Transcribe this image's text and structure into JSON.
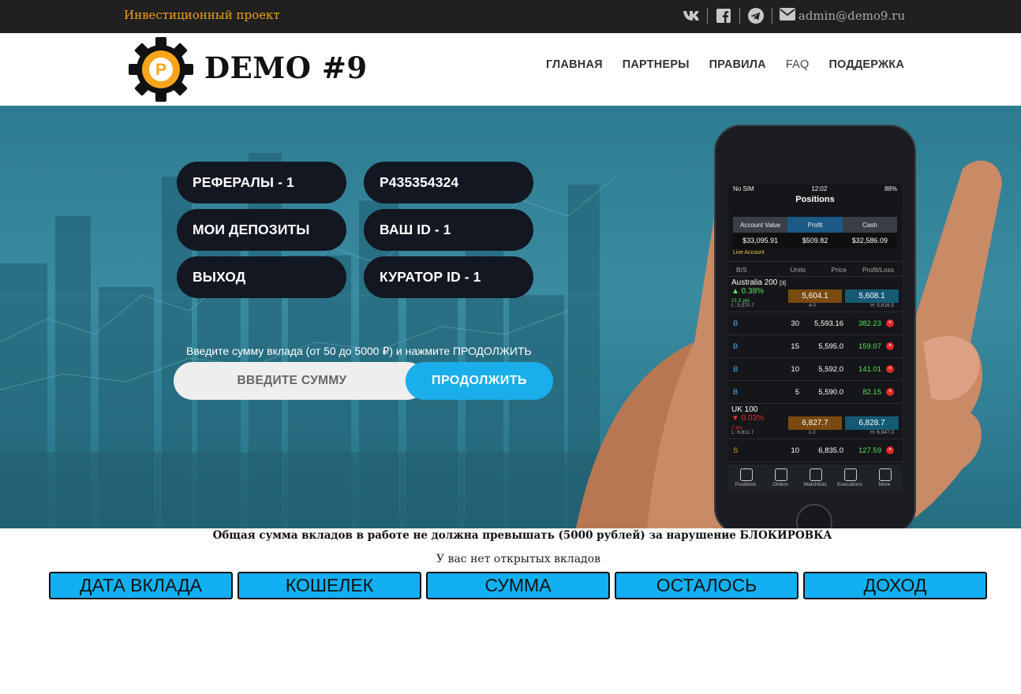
{
  "topbar": {
    "tagline": "Инвестиционный проект",
    "email": "admin@demo9.ru",
    "social_icons": [
      "vk-icon",
      "facebook-icon",
      "telegram-icon",
      "envelope-icon"
    ]
  },
  "header": {
    "logo_glyph": "P",
    "logo_text": "DEMO #9",
    "nav": [
      "ГЛАВНАЯ",
      "ПАРТНЕРЫ",
      "ПРАВИЛА",
      "FAQ",
      "ПОДДЕРЖКА"
    ]
  },
  "hero": {
    "buttons": {
      "referrals": "РЕФЕРАЛЫ - 1",
      "wallet": "P435354324",
      "deposits": "МОИ ДЕПОЗИТЫ",
      "your_id": "ВАШ ID - 1",
      "logout": "ВЫХОД",
      "curator": "КУРАТОР ID - 1"
    },
    "hint": "Введите сумму вклада (от 50 до 5000 ₽) и нажмите ПРОДОЛЖИТЬ",
    "amount_placeholder": "ВВЕДИТЕ СУММУ",
    "continue_label": "ПРОДОЛЖИТЬ"
  },
  "phone": {
    "carrier": "No SIM",
    "time": "12:02",
    "battery": "88%",
    "title": "Positions",
    "tabs": [
      "Account Value",
      "Profit",
      "Cash"
    ],
    "values": [
      "$33,095.91",
      "$509.82",
      "$32,586.09"
    ],
    "live": "Live Account",
    "columns": [
      "B/S",
      "Units",
      "Price",
      "Profit/Loss"
    ],
    "market1": {
      "name": "Australia 200",
      "count": "[3]",
      "change": "▲ 0.38%",
      "pts": "21.5 pts",
      "sell": "5,604.1",
      "buy": "5,608.1",
      "low": "L: 5,570.7",
      "spread": "4.0",
      "high": "H: 5,616.5"
    },
    "positions1": [
      {
        "side": "B",
        "units": "30",
        "price": "5,593.16",
        "pl": "382.23"
      },
      {
        "side": "B",
        "units": "15",
        "price": "5,595.0",
        "pl": "159.07"
      },
      {
        "side": "B",
        "units": "10",
        "price": "5,592.0",
        "pl": "141.01"
      },
      {
        "side": "B",
        "units": "5",
        "price": "5,590.0",
        "pl": "82.15"
      }
    ],
    "market2": {
      "name": "UK 100",
      "change": "▼ 0.03%",
      "pts": "2 pts",
      "sell": "6,827.7",
      "buy": "6,828.7",
      "low": "L: 6,811.7",
      "spread": "1.0",
      "high": "H: 6,847.0"
    },
    "positions2": [
      {
        "side": "S",
        "units": "10",
        "price": "6,835.0",
        "pl": "127.59"
      }
    ],
    "footer": [
      "Positions",
      "Orders",
      "Watchlists",
      "Executions",
      "More"
    ]
  },
  "notice": {
    "warning": "Общая сумма вкладов в работе не должна превышать (5000 рублей) за нарушение БЛОКИРОВКА",
    "no_deposits": "У вас нет открытых вкладов"
  },
  "table": {
    "headers": [
      "ДАТА ВКЛАДА",
      "КОШЕЛЕК",
      "СУММА",
      "ОСТАЛОСЬ",
      "ДОХОД"
    ]
  },
  "colors": {
    "accent": "#1aaeea",
    "tagline": "#f0a020",
    "pill": "#131722",
    "logo": "#f7a51c"
  }
}
